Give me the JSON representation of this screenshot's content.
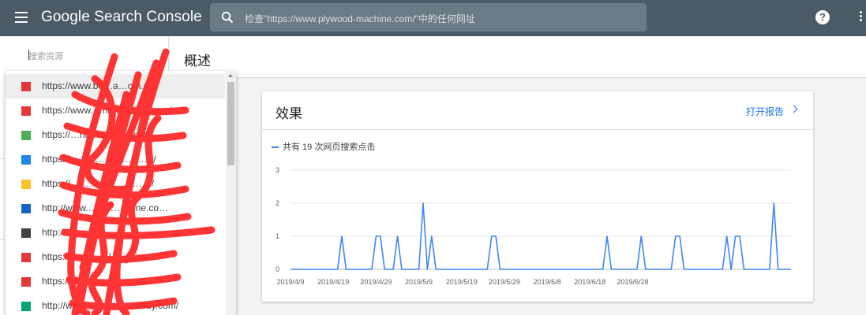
{
  "header": {
    "menu_icon": "menu-icon",
    "brand": "Google Search Console",
    "search_placeholder": "检查\"https://www.plywood-machine.com/\"中的任何网址",
    "help_icon": "help-icon",
    "more_icon": "more-vert-icon"
  },
  "sidebar": {
    "search_placeholder": "搜索资源"
  },
  "page": {
    "title": "概述"
  },
  "dropdown": {
    "items": [
      {
        "url": "https://www.bo…a…om.c…",
        "color": "#e53935"
      },
      {
        "url": "https://www.…hi…on…….com/",
        "color": "#e53935"
      },
      {
        "url": "https://…hi…na…….com/",
        "color": "#4caf50"
      },
      {
        "url": "https://…………io…………/",
        "color": "#1e88e5"
      },
      {
        "url": "https://…………e…………/",
        "color": "#fbc02d"
      },
      {
        "url": "http://www.……………ne.co…",
        "color": "#1565c0"
      },
      {
        "url": "http://…………………/",
        "color": "#424242"
      },
      {
        "url": "https://…………/",
        "color": "#e53935"
      },
      {
        "url": "https://…………/",
        "color": "#e53935"
      },
      {
        "url": "http://www.……………aeuy.com/",
        "color": "#00a86b"
      }
    ]
  },
  "card": {
    "title": "效果",
    "link": "打开报告",
    "legend": "共有 19 次网页搜索点击"
  },
  "chart_data": {
    "type": "line",
    "series": [
      {
        "name": "共有 19 次网页搜索点击",
        "color": "#4285f4",
        "values": [
          0,
          0,
          0,
          0,
          0,
          0,
          0,
          0,
          0,
          0,
          0,
          0,
          1,
          0,
          0,
          0,
          0,
          0,
          0,
          0,
          1,
          1,
          0,
          0,
          0,
          1,
          0,
          0,
          0,
          0,
          0,
          2,
          0,
          1,
          0,
          0,
          0,
          0,
          0,
          0,
          0,
          0,
          0,
          0,
          0,
          0,
          0,
          1,
          1,
          0,
          0,
          0,
          0,
          0,
          0,
          0,
          0,
          0,
          0,
          0,
          0,
          0,
          0,
          0,
          0,
          0,
          0,
          0,
          0,
          0,
          0,
          0,
          0,
          0,
          1,
          0,
          0,
          0,
          0,
          0,
          0,
          0,
          1,
          0,
          0,
          0,
          0,
          0,
          0,
          0,
          1,
          1,
          0,
          0,
          0,
          0,
          0,
          0,
          0,
          0,
          0,
          0,
          1,
          0,
          1,
          1,
          0,
          0,
          0,
          0,
          0,
          0,
          0,
          2,
          0,
          0,
          0,
          0
        ]
      }
    ],
    "x_start": "2019-04-09",
    "xticks": [
      "2019/4/9",
      "2019/4/19",
      "2019/4/29",
      "2019/5/9",
      "2019/5/19",
      "2019/5/29",
      "2019/6/8",
      "2019/6/18",
      "2019/6/28"
    ],
    "yticks": [
      0,
      1,
      2,
      3
    ],
    "ylim": [
      0,
      3
    ],
    "grid": true
  }
}
